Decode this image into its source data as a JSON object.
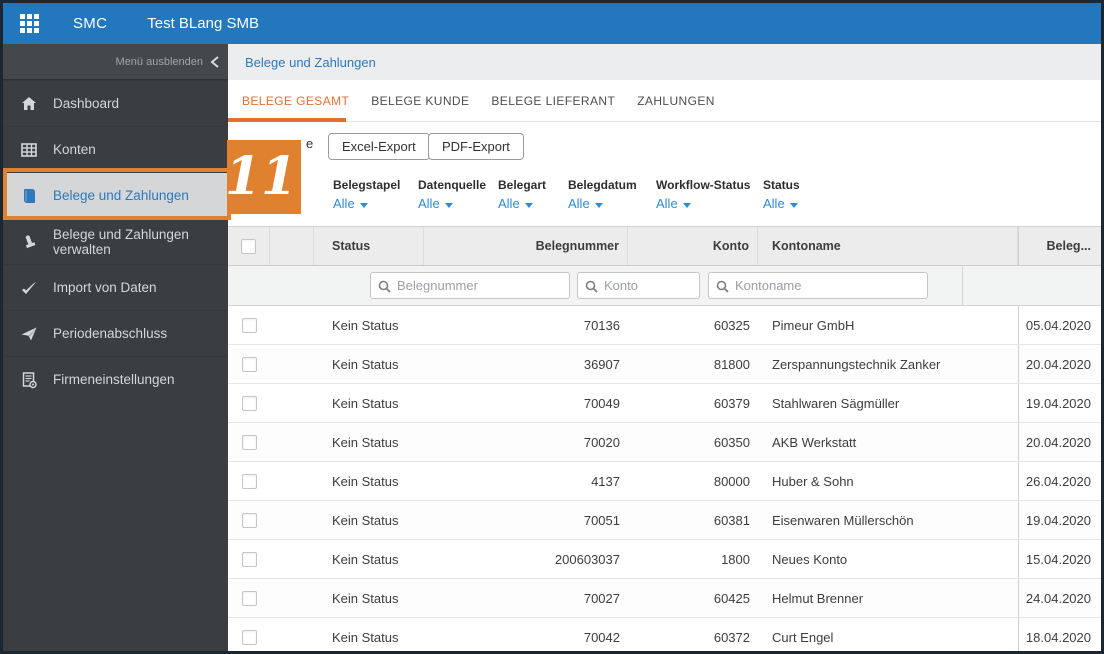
{
  "topbar": {
    "app_name": "SMC",
    "company_name": "Test BLang SMB"
  },
  "sidebar": {
    "collapse_label": "Menü ausblenden",
    "items": [
      {
        "label": "Dashboard"
      },
      {
        "label": "Konten"
      },
      {
        "label": "Belege und Zahlungen"
      },
      {
        "label": "Belege und Zahlungen verwalten"
      },
      {
        "label": "Import von Daten"
      },
      {
        "label": "Periodenabschluss"
      },
      {
        "label": "Firmeneinstellungen"
      }
    ]
  },
  "breadcrumb": {
    "title": "Belege und Zahlungen"
  },
  "tabs": [
    {
      "label": "BELEGE GESAMT"
    },
    {
      "label": "BELEGE KUNDE"
    },
    {
      "label": "BELEGE LIEFERANT"
    },
    {
      "label": "ZAHLUNGEN"
    }
  ],
  "toolbar": {
    "obscured_button_visible_text": "e",
    "excel_export_label": "Excel-Export",
    "pdf_export_label": "PDF-Export"
  },
  "annotation": {
    "step_number": "11",
    "color": "#e0812f"
  },
  "filters": [
    {
      "label": "Belegstapel",
      "value": "Alle"
    },
    {
      "label": "Datenquelle",
      "value": "Alle"
    },
    {
      "label": "Belegart",
      "value": "Alle"
    },
    {
      "label": "Belegdatum",
      "value": "Alle"
    },
    {
      "label": "Workflow-Status",
      "value": "Alle"
    },
    {
      "label": "Status",
      "value": "Alle"
    }
  ],
  "table": {
    "headers": {
      "status": "Status",
      "belegnummer": "Belegnummer",
      "konto": "Konto",
      "kontoname": "Kontoname",
      "belegdatum_truncated": "Beleg..."
    },
    "search_placeholders": {
      "belegnummer": "Belegnummer",
      "konto": "Konto",
      "kontoname": "Kontoname"
    },
    "rows": [
      {
        "status": "Kein Status",
        "belegnummer": "70136",
        "konto": "60325",
        "kontoname": "Pimeur GmbH",
        "belegdatum": "05.04.2020"
      },
      {
        "status": "Kein Status",
        "belegnummer": "36907",
        "konto": "81800",
        "kontoname": "Zerspannungstechnik Zanker",
        "belegdatum": "20.04.2020"
      },
      {
        "status": "Kein Status",
        "belegnummer": "70049",
        "konto": "60379",
        "kontoname": "Stahlwaren Sägmüller",
        "belegdatum": "19.04.2020"
      },
      {
        "status": "Kein Status",
        "belegnummer": "70020",
        "konto": "60350",
        "kontoname": "AKB Werkstatt",
        "belegdatum": "20.04.2020"
      },
      {
        "status": "Kein Status",
        "belegnummer": "4137",
        "konto": "80000",
        "kontoname": "Huber & Sohn",
        "belegdatum": "26.04.2020"
      },
      {
        "status": "Kein Status",
        "belegnummer": "70051",
        "konto": "60381",
        "kontoname": "Eisenwaren Müllerschön",
        "belegdatum": "19.04.2020"
      },
      {
        "status": "Kein Status",
        "belegnummer": "200603037",
        "konto": "1800",
        "kontoname": "Neues Konto",
        "belegdatum": "15.04.2020"
      },
      {
        "status": "Kein Status",
        "belegnummer": "70027",
        "konto": "60425",
        "kontoname": "Helmut Brenner",
        "belegdatum": "24.04.2020"
      },
      {
        "status": "Kein Status",
        "belegnummer": "70042",
        "konto": "60372",
        "kontoname": "Curt Engel",
        "belegdatum": "18.04.2020"
      }
    ]
  },
  "colors": {
    "topbar_blue": "#2377bd",
    "sidebar_dark": "#3a3e41",
    "accent_orange": "#e0812f",
    "tab_active_orange": "#e2712e",
    "link_blue": "#2e78bd",
    "filter_value_blue": "#2e8bd5"
  }
}
